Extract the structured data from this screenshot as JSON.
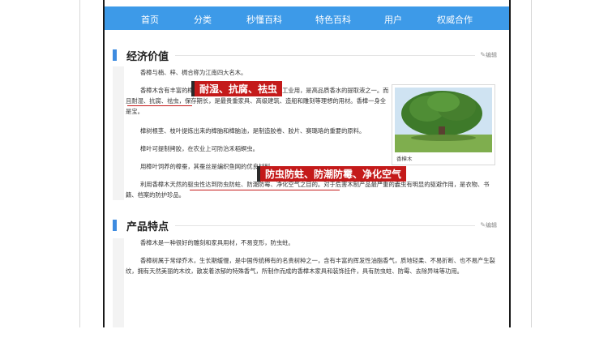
{
  "nav": [
    "首页",
    "分类",
    "秒懂百科",
    "特色百科",
    "用户",
    "权威合作"
  ],
  "edit_label": "编辑",
  "sections": [
    {
      "title": "经济价值",
      "paragraphs": [
        "香樟与楠、梓、椆合称为江南四大名木。",
        "香樟木含有丰富的樟脑油，樟脑和樟油可供医药及香料工业用，是高品质香水的提取液之一。而且耐湿、抗腐、祛虫，保存期长，是最贵重家具、高级建筑、造船和雕刻等理想的用材。香樟一身全是宝。",
        "樟树根茎、枝叶提炼出来的樟脑和樟脑油，是制造胶卷、胶片、赛璐珞的重要的原料。",
        "樟叶可提制拷胶，在农业上可防治禾稻螟虫。",
        "用樟叶饲养的樟蚕，其蚕丝是编织鱼网的优良材料。",
        "利用香樟木天然的驱虫性达到防虫防蛀、防潮防霉、净化空气之目的。对于危害木制产品最严重的蠹虫有明显的驱避作用，是衣物、书籍、档案的防护珍品。"
      ]
    },
    {
      "title": "产品特点",
      "paragraphs": [
        "香樟木是一种很好的雕刻和家具用材，不易变形，防虫蛀。",
        "香樟树属于常绿乔木，生长期缓慢，是中国传统稀有的名贵树种之一，含有丰富的挥发性油脂香气，质地轻柔、不易折断、也不易产生裂纹，拥有天然美丽的木纹，散发着浓郁的特殊香气，所制作而成的香樟木家具和装饰挂件，具有防虫蛀、防霉、去除异味等功用。"
      ]
    }
  ],
  "callouts": [
    "耐湿、抗腐、祛虫",
    "防虫防蛀、防潮防霉、净化空气"
  ],
  "photo_caption": "香樟木",
  "colors": {
    "nav": "#3d9ae8",
    "callout": "#c41a1a",
    "link": "#2b6cc4",
    "section_bar": "#3d8be0"
  }
}
